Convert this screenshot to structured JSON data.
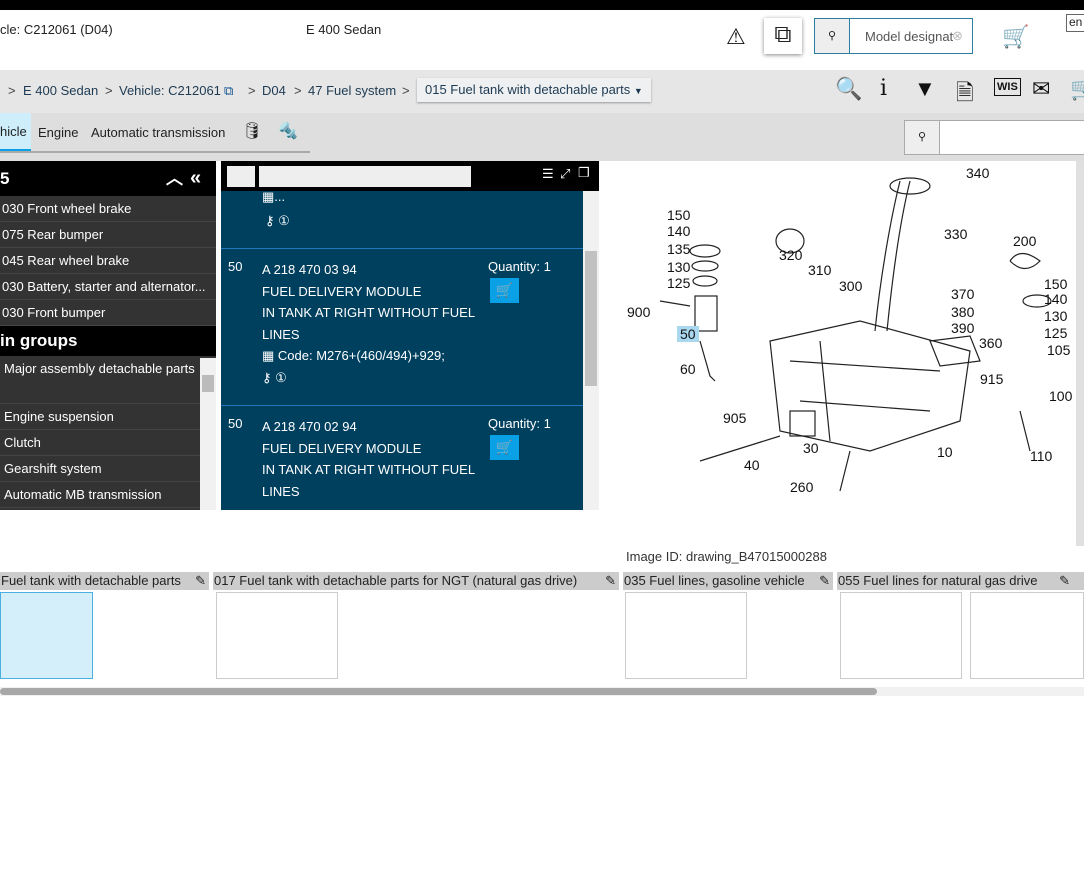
{
  "header": {
    "vehicle": "cle: C212061 (D04)",
    "model": "E 400 Sedan",
    "search_placeholder": "Model designat",
    "lang": "en"
  },
  "breadcrumb": {
    "items": [
      "E 400 Sedan",
      "Vehicle: C212061",
      "D04",
      "47 Fuel system"
    ],
    "current": "015 Fuel tank with detachable parts"
  },
  "tabs": [
    "hicle",
    "Engine",
    "Automatic transmission"
  ],
  "left": {
    "history_title": "5",
    "history": [
      "030 Front wheel brake",
      "075 Rear bumper",
      "045 Rear wheel brake",
      "030 Battery, starter and alternator...",
      "030 Front bumper"
    ],
    "groups_title": "in groups",
    "groups": [
      "Major assembly detachable parts",
      "Engine suspension",
      "Clutch",
      "Gearshift system",
      "Automatic MB transmission"
    ]
  },
  "parts": [
    {
      "partial": true,
      "code": "..."
    },
    {
      "pos": "50",
      "number": "A 218 470 03 94",
      "line1": "FUEL DELIVERY MODULE",
      "line2": "IN TANK AT RIGHT WITHOUT FUEL LINES",
      "code": "Code: M276+(460/494)+929;",
      "qty": "Quantity: 1"
    },
    {
      "pos": "50",
      "number": "A 218 470 02 94",
      "line1": "FUEL DELIVERY MODULE",
      "line2": "IN TANK AT RIGHT WITHOUT FUEL LINES",
      "qty": "Quantity: 1"
    }
  ],
  "diagram": {
    "image_id": "Image ID: drawing_B47015000288",
    "highlight": "50",
    "callouts": [
      "340",
      "150",
      "140",
      "135",
      "130",
      "125",
      "900",
      "50",
      "60",
      "320",
      "310",
      "300",
      "330",
      "200",
      "370",
      "380",
      "390",
      "360",
      "150",
      "140",
      "130",
      "125",
      "105",
      "915",
      "100",
      "905",
      "30",
      "40",
      "10",
      "110",
      "260"
    ]
  },
  "thumbnails": [
    "Fuel tank with detachable parts",
    "017 Fuel tank with detachable parts for NGT (natural gas drive)",
    "035 Fuel lines, gasoline vehicle",
    "055 Fuel lines for natural gas drive"
  ],
  "colors": {
    "accent": "#0aa0e6",
    "panel": "#00405f",
    "dark": "#333333"
  }
}
